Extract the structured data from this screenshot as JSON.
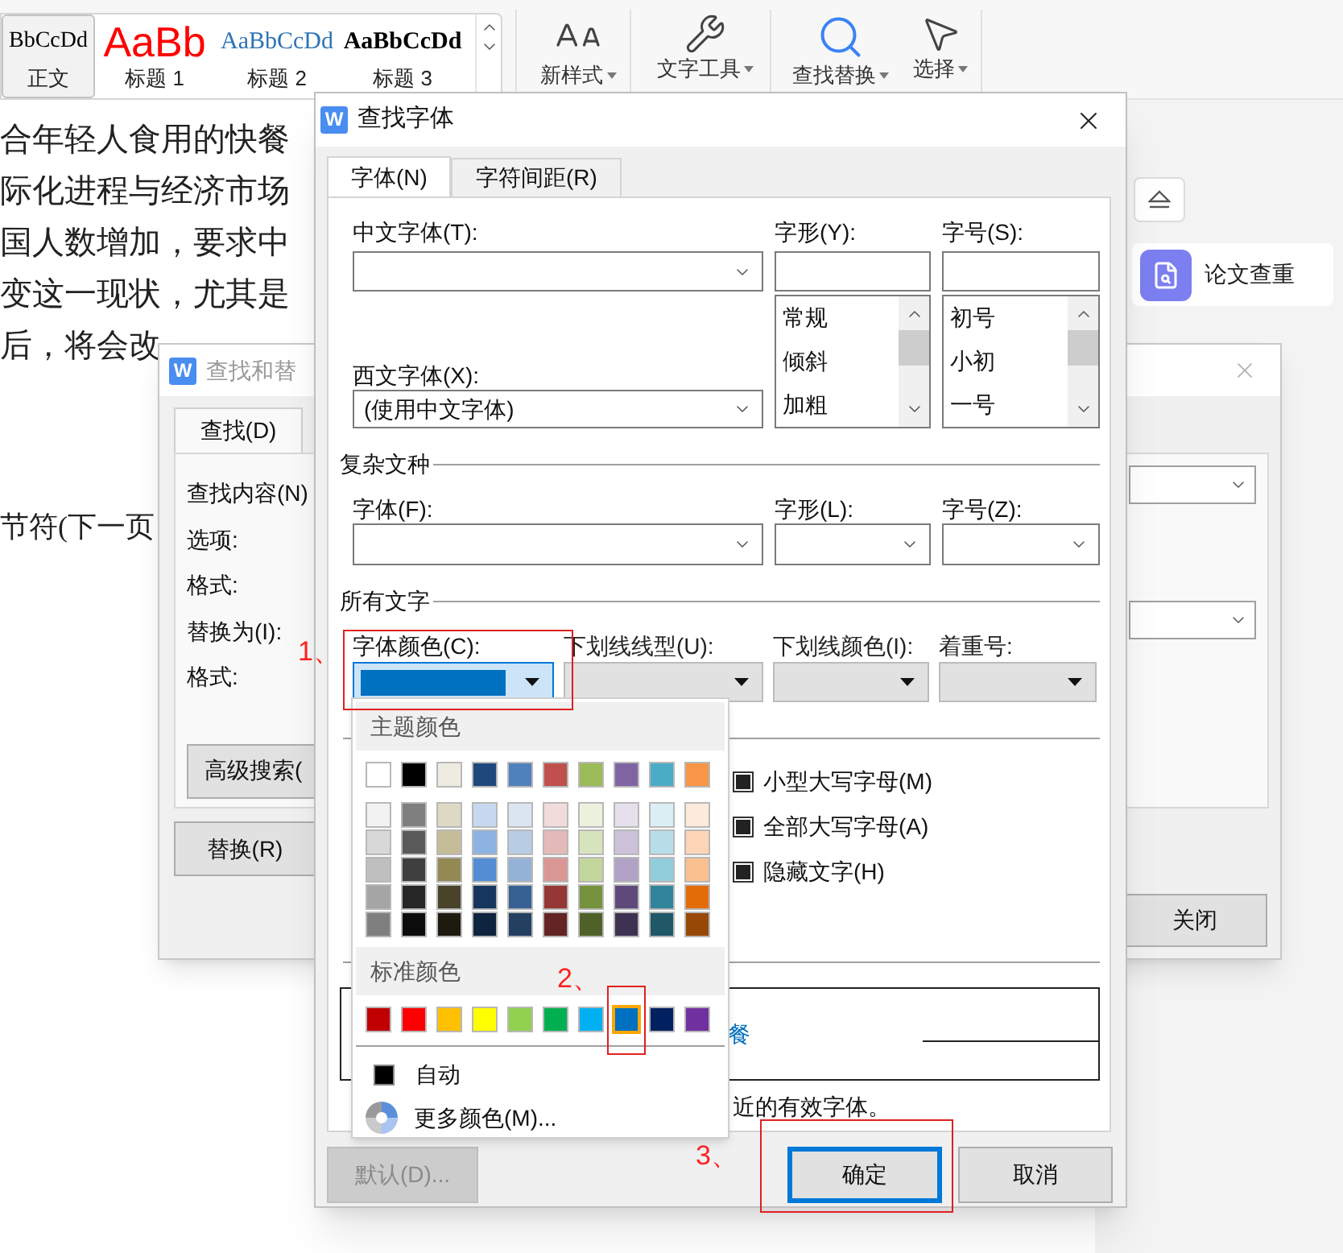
{
  "ribbon": {
    "style_gallery": [
      {
        "preview": "BbCcDd",
        "label": "正文",
        "kind": "body",
        "selected": true
      },
      {
        "preview": "AaBb",
        "label": "标题 1",
        "kind": "heading1",
        "selected": false
      },
      {
        "preview": "AaBbCcDd",
        "label": "标题 2",
        "kind": "heading2",
        "selected": false
      },
      {
        "preview": "AaBbCcDd",
        "label": "标题 3",
        "kind": "heading3",
        "selected": false
      }
    ],
    "tools": [
      {
        "label": "新样式",
        "kind": "new-style"
      },
      {
        "label": "文字工具",
        "kind": "text-tools"
      },
      {
        "label": "查找替换",
        "kind": "find-replace"
      },
      {
        "label": "选择",
        "kind": "select"
      }
    ]
  },
  "document": {
    "lines": [
      "合年轻人食用的快餐",
      "际化进程与经济市场",
      "国人数增加，要求中",
      "变这一现状，尤其是",
      "后，将会改"
    ],
    "section_break": "节符(下一页"
  },
  "side_panel": {
    "button": "论文查重"
  },
  "find_replace_dialog": {
    "icon_letter": "W",
    "title": "查找和替",
    "tabs": [
      {
        "label": "查找(D)",
        "selected": true
      }
    ],
    "labels": [
      "查找内容(N)",
      "选项:",
      "格式:",
      "替换为(I):",
      "格式:"
    ],
    "advanced_button": "高级搜索(",
    "replace_button": "替换(R)",
    "close_button": "关闭"
  },
  "find_font_dialog": {
    "icon_letter": "W",
    "title": "查找字体",
    "tabs": [
      {
        "label": "字体(N)",
        "selected": true
      },
      {
        "label": "字符间距(R)",
        "selected": false
      }
    ],
    "chinese_font": {
      "label": "中文字体(T):"
    },
    "font_style": {
      "label": "字形(Y):",
      "options": [
        "常规",
        "倾斜",
        "加粗"
      ]
    },
    "font_size": {
      "label": "字号(S):",
      "options": [
        "初号",
        "小初",
        "一号"
      ]
    },
    "western_font": {
      "label": "西文字体(X):",
      "value": "(使用中文字体)"
    },
    "complex_script": {
      "heading": "复杂文种",
      "fields": [
        "字体(F):",
        "字形(L):",
        "字号(Z):"
      ]
    },
    "all_text": {
      "heading": "所有文字",
      "fields": [
        {
          "label": "字体颜色(C):",
          "kind": "color",
          "color": "#0070c0",
          "disabled": false
        },
        {
          "label": "下划线线型(U):",
          "kind": "dropdown",
          "disabled": true
        },
        {
          "label": "下划线颜色(I):",
          "kind": "dropdown",
          "disabled": true
        },
        {
          "label": "着重号:",
          "kind": "dropdown",
          "disabled": true
        }
      ]
    },
    "effects": {
      "options": [
        {
          "label": "小型大写字母(M)",
          "checked": true
        },
        {
          "label": "全部大写字母(A)",
          "checked": true
        },
        {
          "label": "隐藏文字(H)",
          "checked": true
        }
      ]
    },
    "preview": {
      "sample": "餐",
      "note": "近的有效字体。"
    },
    "buttons": [
      {
        "label": "默认(D)...",
        "disabled": true,
        "focused": false
      },
      {
        "label": "确定",
        "disabled": false,
        "focused": true
      },
      {
        "label": "取消",
        "disabled": false,
        "focused": false
      }
    ]
  },
  "color_menu": {
    "theme_heading": "主题颜色",
    "theme_colors": [
      {
        "color": "#ffffff",
        "selected": false
      },
      {
        "color": "#000000",
        "selected": false
      },
      {
        "color": "#eeece1",
        "selected": false
      },
      {
        "color": "#1f497d",
        "selected": false
      },
      {
        "color": "#4f81bd",
        "selected": false
      },
      {
        "color": "#c0504d",
        "selected": false
      },
      {
        "color": "#9bbb59",
        "selected": false
      },
      {
        "color": "#8064a2",
        "selected": false
      },
      {
        "color": "#4bacc6",
        "selected": false
      },
      {
        "color": "#f79646",
        "selected": false
      }
    ],
    "shade_rows": [
      {
        "swatches": [
          {
            "color": "#f2f2f2",
            "selected": false
          },
          {
            "color": "#7f7f7f",
            "selected": false
          },
          {
            "color": "#ddd9c3",
            "selected": false
          },
          {
            "color": "#c6d9f0",
            "selected": false
          },
          {
            "color": "#dbe5f1",
            "selected": false
          },
          {
            "color": "#f2dcdb",
            "selected": false
          },
          {
            "color": "#ebf1dd",
            "selected": false
          },
          {
            "color": "#e5e0ec",
            "selected": false
          },
          {
            "color": "#dbeef3",
            "selected": false
          },
          {
            "color": "#fdeada",
            "selected": false
          }
        ]
      },
      {
        "swatches": [
          {
            "color": "#d8d8d8",
            "selected": false
          },
          {
            "color": "#595959",
            "selected": false
          },
          {
            "color": "#c4bd97",
            "selected": false
          },
          {
            "color": "#8db3e2",
            "selected": false
          },
          {
            "color": "#b8cce4",
            "selected": false
          },
          {
            "color": "#e5b9b7",
            "selected": false
          },
          {
            "color": "#d7e3bc",
            "selected": false
          },
          {
            "color": "#ccc1d9",
            "selected": false
          },
          {
            "color": "#b7dde8",
            "selected": false
          },
          {
            "color": "#fbd5b5",
            "selected": false
          }
        ]
      },
      {
        "swatches": [
          {
            "color": "#bfbfbf",
            "selected": false
          },
          {
            "color": "#3f3f3f",
            "selected": false
          },
          {
            "color": "#938953",
            "selected": false
          },
          {
            "color": "#548dd4",
            "selected": false
          },
          {
            "color": "#95b3d7",
            "selected": false
          },
          {
            "color": "#d99694",
            "selected": false
          },
          {
            "color": "#c3d69b",
            "selected": false
          },
          {
            "color": "#b2a2c7",
            "selected": false
          },
          {
            "color": "#92cddc",
            "selected": false
          },
          {
            "color": "#fac08f",
            "selected": false
          }
        ]
      },
      {
        "swatches": [
          {
            "color": "#a5a5a5",
            "selected": false
          },
          {
            "color": "#262626",
            "selected": false
          },
          {
            "color": "#494429",
            "selected": false
          },
          {
            "color": "#17365d",
            "selected": false
          },
          {
            "color": "#366092",
            "selected": false
          },
          {
            "color": "#953734",
            "selected": false
          },
          {
            "color": "#76923c",
            "selected": false
          },
          {
            "color": "#5f497a",
            "selected": false
          },
          {
            "color": "#31859b",
            "selected": false
          },
          {
            "color": "#e36c09",
            "selected": false
          }
        ]
      },
      {
        "swatches": [
          {
            "color": "#7f7f7f",
            "selected": false
          },
          {
            "color": "#0c0c0c",
            "selected": false
          },
          {
            "color": "#1d1b10",
            "selected": false
          },
          {
            "color": "#0f243e",
            "selected": false
          },
          {
            "color": "#244061",
            "selected": false
          },
          {
            "color": "#632423",
            "selected": false
          },
          {
            "color": "#4f6128",
            "selected": false
          },
          {
            "color": "#3f3151",
            "selected": false
          },
          {
            "color": "#205867",
            "selected": false
          },
          {
            "color": "#974806",
            "selected": false
          }
        ]
      }
    ],
    "standard_heading": "标准颜色",
    "standard_colors": [
      {
        "color": "#c00000",
        "selected": false
      },
      {
        "color": "#ff0000",
        "selected": false
      },
      {
        "color": "#ffc000",
        "selected": false
      },
      {
        "color": "#ffff00",
        "selected": false
      },
      {
        "color": "#92d050",
        "selected": false
      },
      {
        "color": "#00b050",
        "selected": false
      },
      {
        "color": "#00b0f0",
        "selected": false
      },
      {
        "color": "#0070c0",
        "selected": true
      },
      {
        "color": "#002060",
        "selected": false
      },
      {
        "color": "#7030a0",
        "selected": false
      }
    ],
    "automatic": "自动",
    "more_colors": "更多颜色(M)..."
  },
  "annotations": [
    {
      "label": "1、"
    },
    {
      "label": "2、"
    },
    {
      "label": "3、"
    }
  ]
}
